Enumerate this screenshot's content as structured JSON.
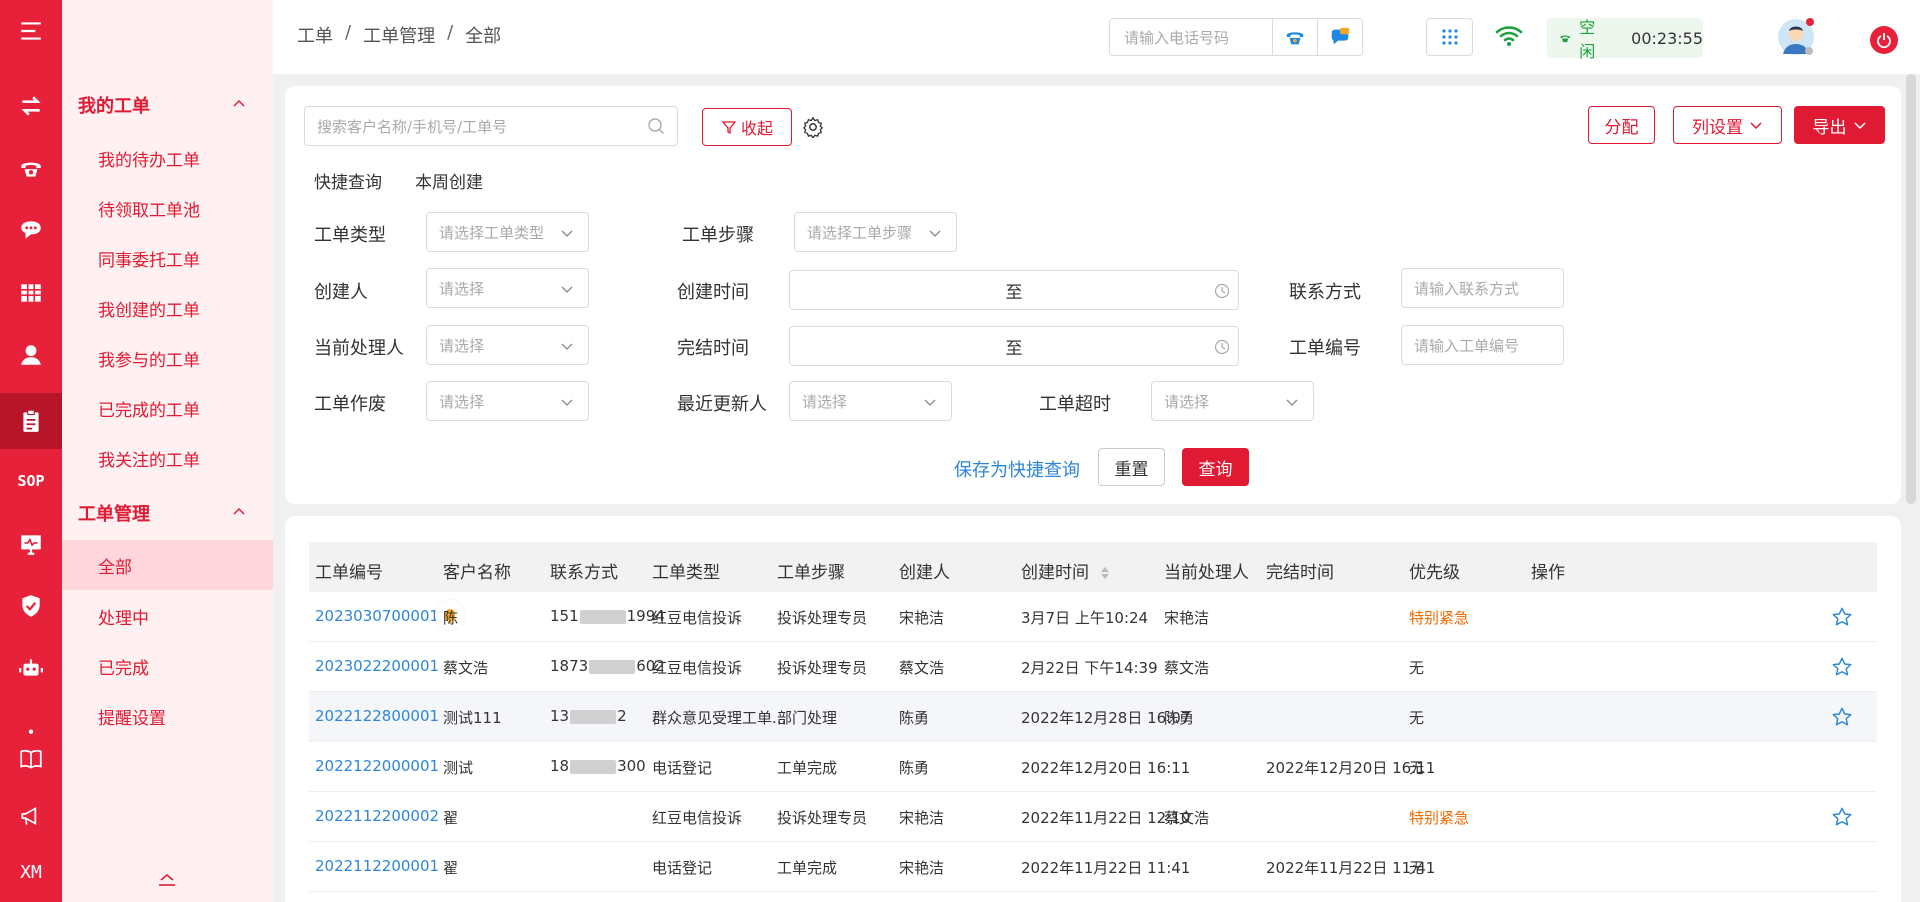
{
  "rail": {
    "items": [
      "menu-icon",
      "transfer-icon",
      "phone-icon",
      "chat-icon",
      "grid-icon",
      "user-icon",
      "clipboard-icon",
      "sop-label",
      "monitor-icon",
      "shield-icon",
      "robot-icon",
      "dot-icon",
      "book-icon",
      "megaphone-icon",
      "xm-label"
    ],
    "sop": "SOP",
    "xm": "XM"
  },
  "sidebar": {
    "group1": "我的工单",
    "group1_items": [
      "我的待办工单",
      "待领取工单池",
      "同事委托工单",
      "我创建的工单",
      "我参与的工单",
      "已完成的工单",
      "我关注的工单"
    ],
    "group2": "工单管理",
    "group2_items": [
      "全部",
      "处理中",
      "已完成",
      "提醒设置"
    ]
  },
  "header": {
    "breadcrumb": [
      "工单",
      "工单管理",
      "全部"
    ],
    "phone_placeholder": "请输入电话号码",
    "status": "空闲",
    "timer": "00:23:55"
  },
  "filters": {
    "search_placeholder": "搜索客户名称/手机号/工单号",
    "collapse_label": "收起",
    "assign_label": "分配",
    "columns_label": "列设置",
    "export_label": "导出",
    "quick_query": "快捷查询",
    "quick_this_week": "本周创建",
    "type_label": "工单类型",
    "type_placeholder": "请选择工单类型",
    "step_label": "工单步骤",
    "step_placeholder": "请选择工单步骤",
    "creator_label": "创建人",
    "creator_placeholder": "请选择",
    "created_time_label": "创建时间",
    "range_sep": "至",
    "contact_label": "联系方式",
    "contact_placeholder": "请输入联系方式",
    "handler_label": "当前处理人",
    "handler_placeholder": "请选择",
    "finished_time_label": "完结时间",
    "number_label": "工单编号",
    "number_placeholder": "请输入工单编号",
    "void_label": "工单作废",
    "void_placeholder": "请选择",
    "updater_label": "最近更新人",
    "updater_placeholder": "请选择",
    "timeout_label": "工单超时",
    "timeout_placeholder": "请选择",
    "save_quick": "保存为快捷查询",
    "reset": "重置",
    "query": "查询"
  },
  "table": {
    "columns": [
      "工单编号",
      "客户名称",
      "联系方式",
      "工单类型",
      "工单步骤",
      "创建人",
      "创建时间",
      "当前处理人",
      "完结时间",
      "优先级",
      "操作"
    ],
    "rows": [
      {
        "id": "2023030700001",
        "customer": "陈",
        "phone_a": "151",
        "phone_b": "1994",
        "type": "红豆电信投诉",
        "step": "投诉处理专员",
        "creator": "宋艳洁",
        "created": "3月7日 上午10:24",
        "handler": "宋艳洁",
        "finished": "",
        "priority": "特别紧急",
        "urgent": true,
        "bell": true,
        "star": true
      },
      {
        "id": "2023022200001",
        "customer": "蔡文浩",
        "phone_a": "1873",
        "phone_b": "602",
        "type": "红豆电信投诉",
        "step": "投诉处理专员",
        "creator": "蔡文浩",
        "created": "2月22日 下午14:39",
        "handler": "蔡文浩",
        "finished": "",
        "priority": "无",
        "urgent": false,
        "bell": false,
        "star": true
      },
      {
        "id": "2022122800001",
        "customer": "测试111",
        "phone_a": "13",
        "phone_b": "2",
        "type": "群众意见受理工单...",
        "step": "部门处理",
        "creator": "陈勇",
        "created": "2022年12月28日 16:07",
        "handler": "陈勇",
        "finished": "",
        "priority": "无",
        "urgent": false,
        "bell": false,
        "star": true
      },
      {
        "id": "2022122000001",
        "customer": "测试",
        "phone_a": "18",
        "phone_b": "300",
        "type": "电话登记",
        "step": "工单完成",
        "creator": "陈勇",
        "created": "2022年12月20日 16:11",
        "handler": "",
        "finished": "2022年12月20日 16:11",
        "priority": "无",
        "urgent": false,
        "bell": false,
        "star": false
      },
      {
        "id": "2022112200002",
        "customer": "翟",
        "phone_a": "",
        "phone_b": "",
        "type": "红豆电信投诉",
        "step": "投诉处理专员",
        "creator": "宋艳洁",
        "created": "2022年11月22日 12:10",
        "handler": "蔡文浩",
        "finished": "",
        "priority": "特别紧急",
        "urgent": true,
        "bell": false,
        "star": true
      },
      {
        "id": "2022112200001",
        "customer": "翟",
        "phone_a": "",
        "phone_b": "",
        "type": "电话登记",
        "step": "工单完成",
        "creator": "宋艳洁",
        "created": "2022年11月22日 11:41",
        "handler": "",
        "finished": "2022年11月22日 11:41",
        "priority": "无",
        "urgent": false,
        "bell": false,
        "star": false
      }
    ]
  },
  "colors": {
    "brand": "#e8213b",
    "link": "#2d86d9",
    "urgent": "#f06a00",
    "idle": "#1aa13c"
  }
}
